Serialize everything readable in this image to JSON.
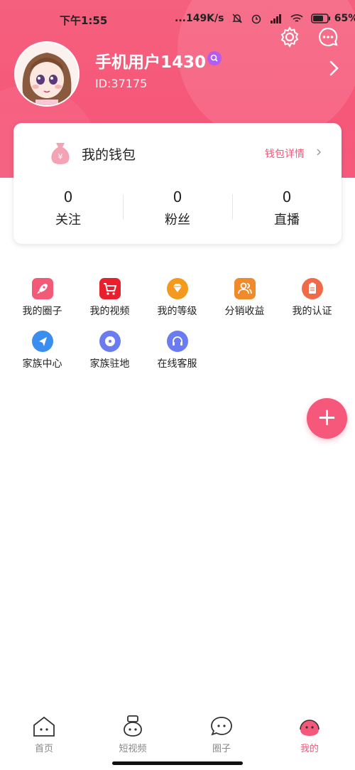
{
  "status_bar": {
    "time": "下午1:55",
    "network_speed": "...149K/s",
    "battery": "65%"
  },
  "profile": {
    "username": "手机用户1430",
    "user_id": "ID:37175"
  },
  "wallet": {
    "title": "我的钱包",
    "detail_link": "钱包详情",
    "stats": [
      {
        "value": "0",
        "label": "关注"
      },
      {
        "value": "0",
        "label": "粉丝"
      },
      {
        "value": "0",
        "label": "直播"
      }
    ]
  },
  "menu": [
    {
      "label": "我的圈子",
      "icon": "rocket-icon",
      "color": "#f25a78"
    },
    {
      "label": "我的视频",
      "icon": "cart-icon",
      "color": "#e8202e"
    },
    {
      "label": "我的等级",
      "icon": "diamond-icon",
      "color": "#f39a1e"
    },
    {
      "label": "分销收益",
      "icon": "people-icon",
      "color": "#f08a2a"
    },
    {
      "label": "我的认证",
      "icon": "clipboard-icon",
      "color": "#f06a4a"
    },
    {
      "label": "家族中心",
      "icon": "navigation-icon",
      "color": "#3a8ef0"
    },
    {
      "label": "家族驻地",
      "icon": "disc-icon",
      "color": "#6a7cf0"
    },
    {
      "label": "在线客服",
      "icon": "headset-icon",
      "color": "#6a7cf0"
    }
  ],
  "fab": {
    "label": "+"
  },
  "tabs": [
    {
      "label": "首页",
      "icon": "home-icon",
      "active": false
    },
    {
      "label": "短视频",
      "icon": "video-robot-icon",
      "active": false
    },
    {
      "label": "圈子",
      "icon": "chat-bubble-icon",
      "active": false
    },
    {
      "label": "我的",
      "icon": "profile-blob-icon",
      "active": true
    }
  ],
  "colors": {
    "accent": "#f5587a",
    "header": "#f6587a",
    "badge": "#b25cf0"
  }
}
